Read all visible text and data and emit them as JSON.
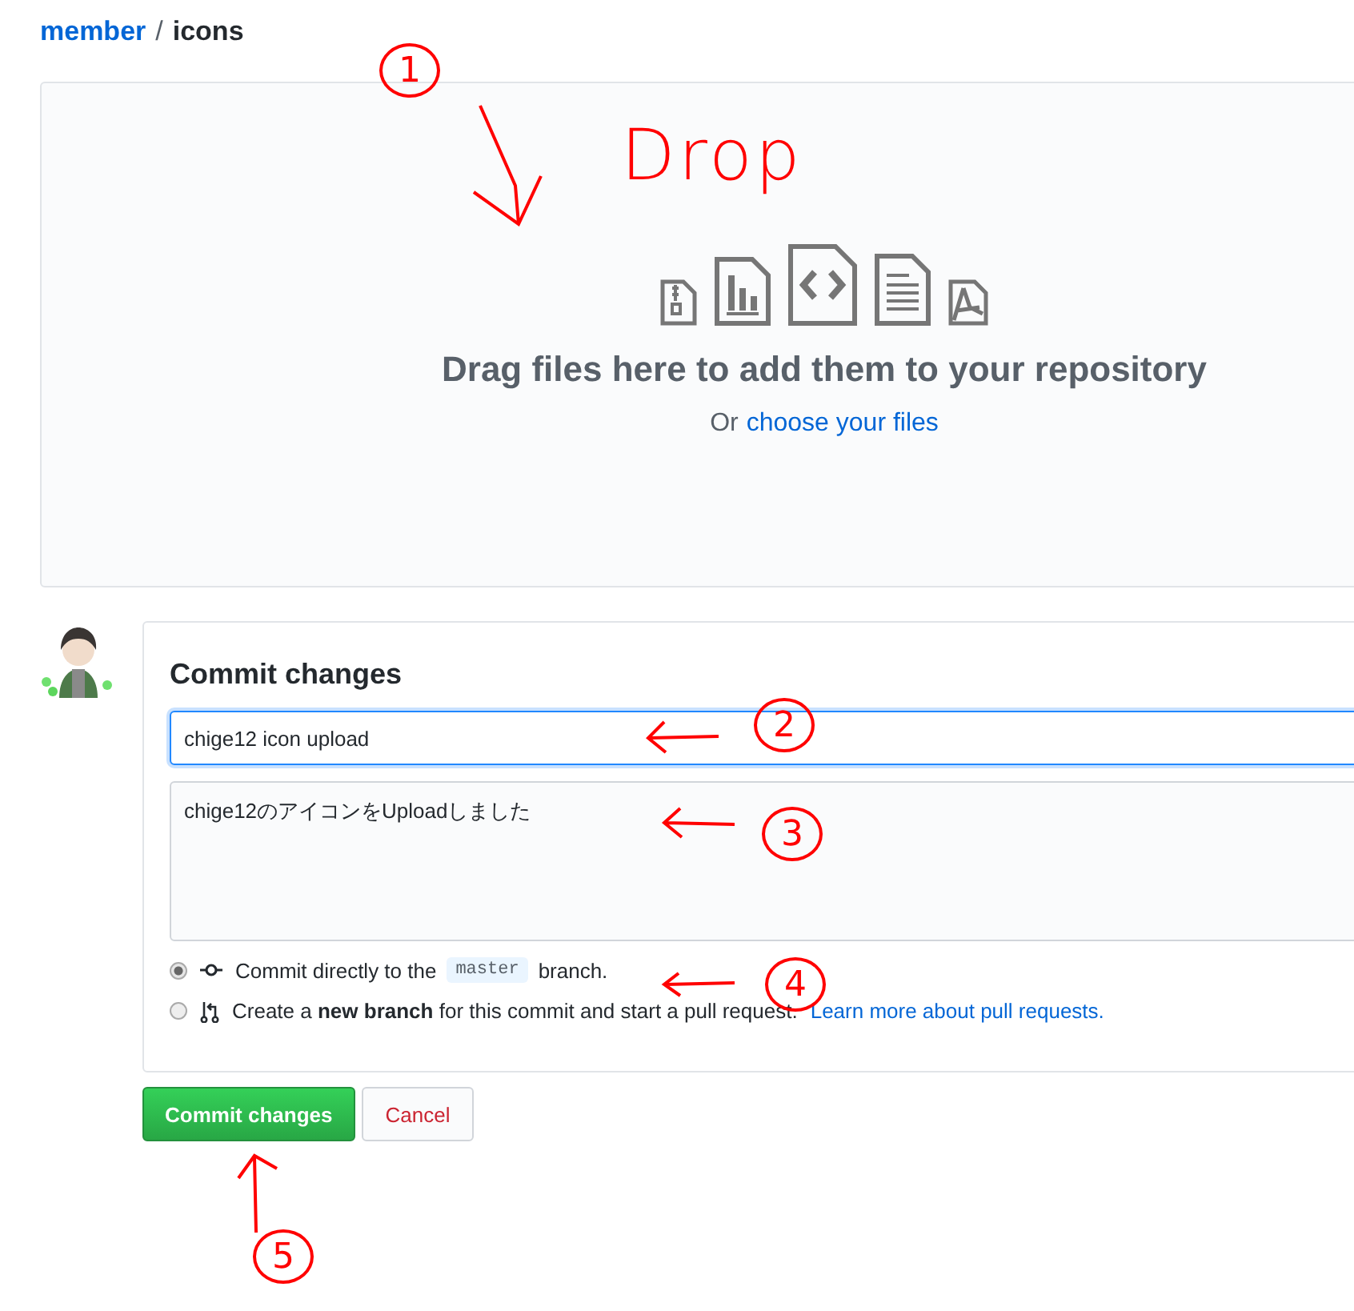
{
  "breadcrumb": {
    "repo": "member",
    "separator": "/",
    "folder": "icons"
  },
  "drop_zone": {
    "title": "Drag files here to add them to your repository",
    "prefix": "Or",
    "link": "choose your files"
  },
  "commit": {
    "title": "Commit changes",
    "summary": "chige12 icon upload",
    "description": "chige12のアイコンをUploadしました",
    "options": [
      {
        "kind": "direct",
        "selected": true,
        "before": "Commit directly to the",
        "branch": "master",
        "after": "branch."
      },
      {
        "kind": "new_branch",
        "selected": false,
        "text": "Create a **new branch** for this commit and start a pull request.",
        "link": "Learn more about pull requests."
      }
    ],
    "buttons": [
      {
        "kind": "primary",
        "label": "Commit changes"
      },
      {
        "kind": "cancel",
        "label": "Cancel"
      }
    ]
  },
  "annotations": [
    {
      "kind": "number",
      "text": "1"
    },
    {
      "kind": "word",
      "text": "Drop"
    },
    {
      "kind": "number",
      "text": "2"
    },
    {
      "kind": "number",
      "text": "3"
    },
    {
      "kind": "number",
      "text": "4"
    },
    {
      "kind": "number",
      "text": "5"
    }
  ]
}
